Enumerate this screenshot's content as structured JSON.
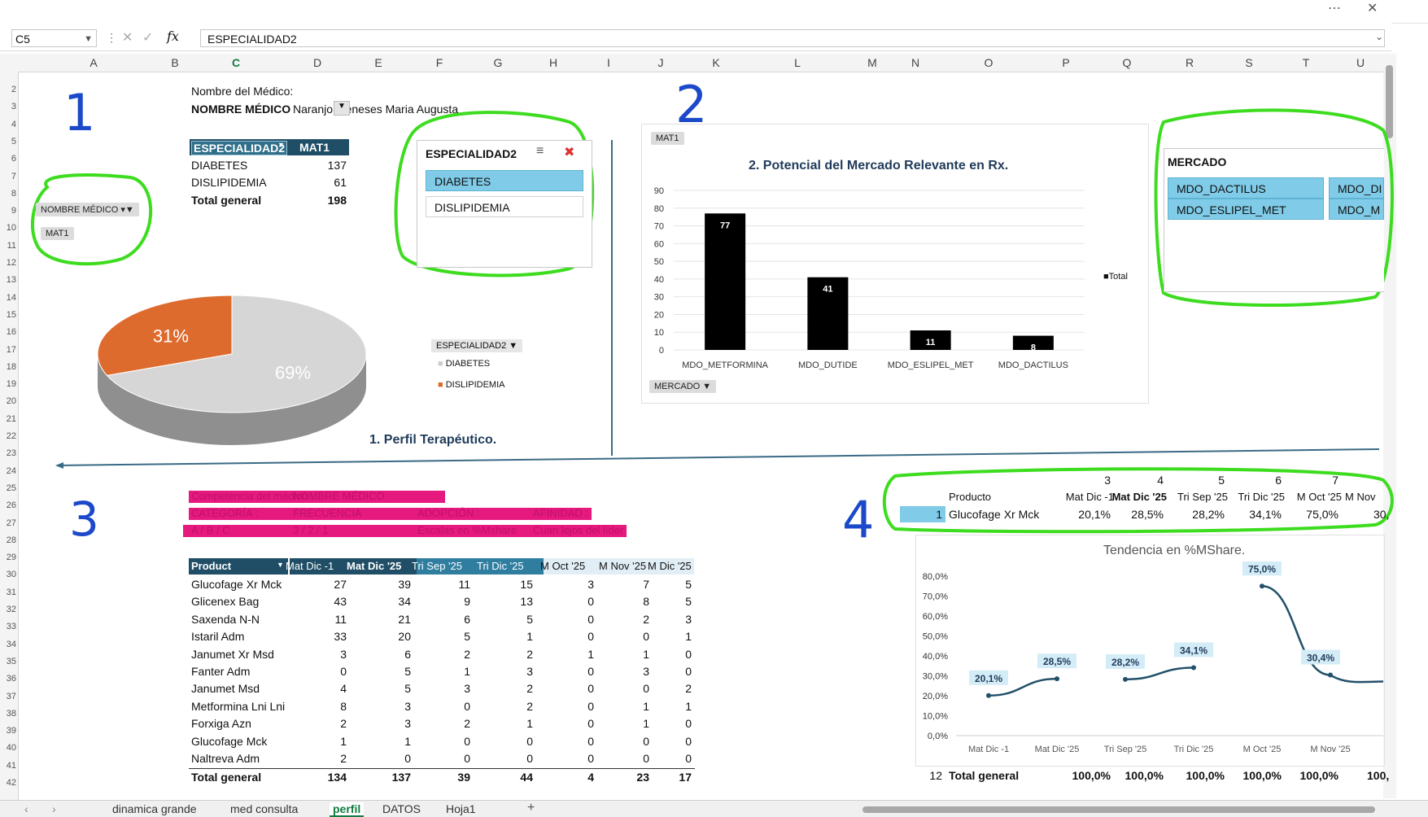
{
  "formula_bar": {
    "name_box": "C5",
    "fx": "fx",
    "formula": "ESPECIALIDAD2"
  },
  "columns": [
    "A",
    "B",
    "C",
    "D",
    "E",
    "F",
    "G",
    "H",
    "I",
    "J",
    "K",
    "L",
    "M",
    "N",
    "O",
    "P",
    "Q",
    "R",
    "S",
    "T",
    "U"
  ],
  "rows": [
    "2",
    "3",
    "4",
    "5",
    "6",
    "7",
    "8",
    "9",
    "10",
    "11",
    "12",
    "13",
    "14",
    "15",
    "16",
    "17",
    "18",
    "19",
    "20",
    "21",
    "22",
    "23",
    "24",
    "25",
    "26",
    "27",
    "28",
    "29",
    "30",
    "31",
    "32",
    "33",
    "34",
    "35",
    "36",
    "37",
    "38",
    "39",
    "40",
    "41",
    "42"
  ],
  "annotations": {
    "n1": "1",
    "n2": "2",
    "n3": "3",
    "n4": "4"
  },
  "section1": {
    "medico_label": "Nombre del Médico:",
    "medico_field": "NOMBRE MÉDICO",
    "medico_value": "Naranjo Meneses Maria Augusta",
    "pivot_header": [
      "ESPECIALIDAD2",
      "MAT1"
    ],
    "pivot_rows": [
      [
        "DIABETES",
        "137"
      ],
      [
        "DISLIPIDEMIA",
        "61"
      ]
    ],
    "pivot_total": [
      "Total general",
      "198"
    ],
    "filter_pill": "NOMBRE MÉDICO",
    "mat_pill": "MAT1",
    "slicer_title": "ESPECIALIDAD2",
    "slicer_items": [
      "DIABETES",
      "DISLIPIDEMIA"
    ],
    "pie_labels": [
      "31%",
      "69%"
    ],
    "legend_title": "ESPECIALIDAD2",
    "legend_items": [
      "DIABETES",
      "DISLIPIDEMIA"
    ],
    "title": "1. Perfil Terapéutico."
  },
  "chart_data": [
    {
      "type": "pie",
      "values": [
        31,
        69
      ],
      "categories": [
        "DISLIPIDEMIA",
        "DIABETES"
      ],
      "colors": [
        "#de6b2e",
        "#d6d6d6"
      ],
      "labels": [
        "31%",
        "69%"
      ]
    },
    {
      "type": "bar",
      "title": "2. Potencial del Mercado Relevante en Rx.",
      "categories": [
        "MDO_METFORMINA",
        "MDO_DUTIDE",
        "MDO_ESLIPEL_MET",
        "MDO_DACTILUS"
      ],
      "values": [
        77,
        41,
        11,
        8
      ],
      "ylim": [
        0,
        90
      ],
      "yticks": [
        "0",
        "10",
        "20",
        "30",
        "40",
        "50",
        "60",
        "70",
        "80",
        "90"
      ],
      "legend": "Total",
      "grid": true,
      "field_pill": "MAT1",
      "axis_pill": "MERCADO"
    },
    {
      "type": "line",
      "title": "Tendencia en %MShare.",
      "categories": [
        "Mat Dic -1",
        "Mat Dic '25",
        "Tri Sep '25",
        "Tri Dic '25",
        "M Oct '25",
        "M Nov '25"
      ],
      "values": [
        20.1,
        28.5,
        28.2,
        34.1,
        75.0,
        30.4
      ],
      "labels": [
        "20,1%",
        "28,5%",
        "28,2%",
        "34,1%",
        "75,0%",
        "30,4%"
      ],
      "ylim": [
        0,
        80
      ],
      "yticks": [
        "0,0%",
        "10,0%",
        "20,0%",
        "30,0%",
        "40,0%",
        "50,0%",
        "60,0%",
        "70,0%",
        "80,0%"
      ]
    }
  ],
  "mercado_slicer": {
    "title": "MERCADO",
    "items": [
      "MDO_DACTILUS",
      "MDO_DI",
      "MDO_ESLIPEL_MET",
      "MDO_M"
    ]
  },
  "section3": {
    "magenta_rows": [
      [
        "Competencia del médico :",
        "NOMBRE MÉDICO",
        "",
        ""
      ],
      [
        "CATEGORÍA :",
        "FRECUENCIA",
        "ADOPCIÓN :",
        "AFINIDAD :"
      ],
      [
        "A / B / C",
        "3 / 2 / 1",
        "Escalas en %Mshare",
        "Cuan lejos del líder"
      ]
    ],
    "headers": [
      "Product",
      "Mat Dic -1",
      "Mat Dic '25",
      "Tri Sep '25",
      "Tri Dic '25",
      "M Oct '25",
      "M Nov '25",
      "M Dic '25"
    ],
    "rows": [
      [
        "Glucofage Xr Mck",
        "27",
        "39",
        "11",
        "15",
        "3",
        "7",
        "5"
      ],
      [
        "Glicenex Bag",
        "43",
        "34",
        "9",
        "13",
        "0",
        "8",
        "5"
      ],
      [
        "Saxenda N-N",
        "11",
        "21",
        "6",
        "5",
        "0",
        "2",
        "3"
      ],
      [
        "Istaril Adm",
        "33",
        "20",
        "5",
        "1",
        "0",
        "0",
        "1"
      ],
      [
        "Janumet Xr Msd",
        "3",
        "6",
        "2",
        "2",
        "1",
        "1",
        "0"
      ],
      [
        "Fanter Adm",
        "0",
        "5",
        "1",
        "3",
        "0",
        "3",
        "0"
      ],
      [
        "Janumet Msd",
        "4",
        "5",
        "3",
        "2",
        "0",
        "0",
        "2"
      ],
      [
        "Metformina Lni Lni",
        "8",
        "3",
        "0",
        "2",
        "0",
        "1",
        "1"
      ],
      [
        "Forxiga Azn",
        "2",
        "3",
        "2",
        "1",
        "0",
        "1",
        "0"
      ],
      [
        "Glucofage Mck",
        "1",
        "1",
        "0",
        "0",
        "0",
        "0",
        "0"
      ],
      [
        "Naltreva Adm",
        "2",
        "0",
        "0",
        "0",
        "0",
        "0",
        "0"
      ]
    ],
    "total": [
      "Total general",
      "134",
      "137",
      "39",
      "44",
      "4",
      "23",
      "17"
    ]
  },
  "section4": {
    "col_numbers": [
      "3",
      "4",
      "5",
      "6",
      "7"
    ],
    "headers": [
      "Producto",
      "Mat Dic -1",
      "Mat Dic '25",
      "Tri Sep '25",
      "Tri Dic '25",
      "M Oct '25",
      "M Nov"
    ],
    "row": [
      "1",
      "Glucofage Xr Mck",
      "20,1%",
      "28,5%",
      "28,2%",
      "34,1%",
      "75,0%",
      "30,"
    ],
    "total": [
      "12",
      "Total general",
      "100,0%",
      "100,0%",
      "100,0%",
      "100,0%",
      "100,0%",
      "100,"
    ]
  },
  "sheet_tabs": [
    "dinamica grande",
    "med consulta",
    "perfil",
    "DATOS",
    "Hoja1"
  ],
  "active_tab": "perfil",
  "colors": {
    "accent_dark": "#1f4e66",
    "slicer_selected": "#7fcbe8",
    "orange": "#de6b2e",
    "annotation_green": "#3ddc1f",
    "magenta": "#e6197f"
  }
}
